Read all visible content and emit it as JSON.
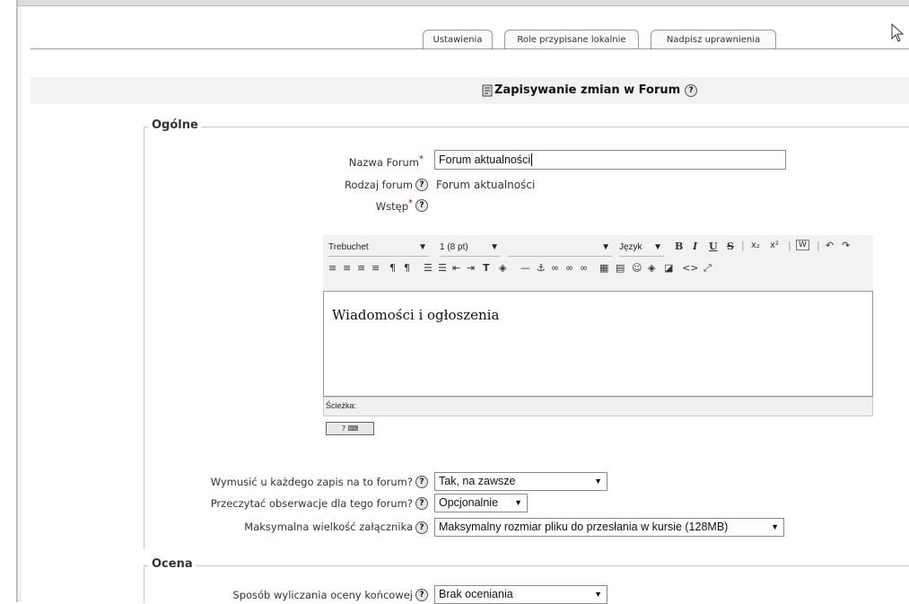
{
  "tabs": [
    {
      "label": "Ustawienia"
    },
    {
      "label": "Role przypisane lokalnie"
    },
    {
      "label": "Nadpisz uprawnienia"
    }
  ],
  "header": {
    "title": "Zapisywanie zmian w Forum",
    "help_symbol": "?"
  },
  "general": {
    "legend": "Ogólne",
    "forum_name": {
      "label": "Nazwa Forum",
      "required_mark": "*",
      "value": "Forum aktualności"
    },
    "forum_type": {
      "label": "Rodzaj forum",
      "value": "Forum aktualności"
    },
    "intro": {
      "label": "Wstęp",
      "required_mark": "*"
    },
    "editor": {
      "font": "Trebuchet",
      "size": "1 (8 pt)",
      "format": "",
      "language": "Język",
      "content": "Wiadomości i ogłoszenia",
      "path_label": "Ścieżka:",
      "toolbar_row1": [
        "B",
        "I",
        "U",
        "S",
        "x₂",
        "x²",
        "W",
        "↶",
        "↷"
      ],
      "toolbar_row2": [
        "≡",
        "≡",
        "≡",
        "≡",
        "¶",
        "¶",
        "☰",
        "☰",
        "⇤",
        "⇥",
        "T",
        "◈",
        "—",
        "⚓",
        "∞",
        "∞",
        "∞",
        "▦",
        "▤",
        "☺",
        "◈",
        "◪",
        "<>",
        "⤢"
      ]
    },
    "force_subscribe": {
      "label": "Wymusić u każdego zapis na to forum?",
      "value": "Tak, na zawsze"
    },
    "read_tracking": {
      "label": "Przeczytać obserwacje dla tego forum?",
      "value": "Opcjonalnie"
    },
    "max_attachment": {
      "label": "Maksymalna wielkość załącznika",
      "value": "Maksymalny rozmiar pliku do przesłania w kursie (128MB)"
    }
  },
  "grade": {
    "legend": "Ocena",
    "aggregate": {
      "label": "Sposób wyliczania oceny końcowej",
      "value": "Brak oceniania"
    }
  }
}
